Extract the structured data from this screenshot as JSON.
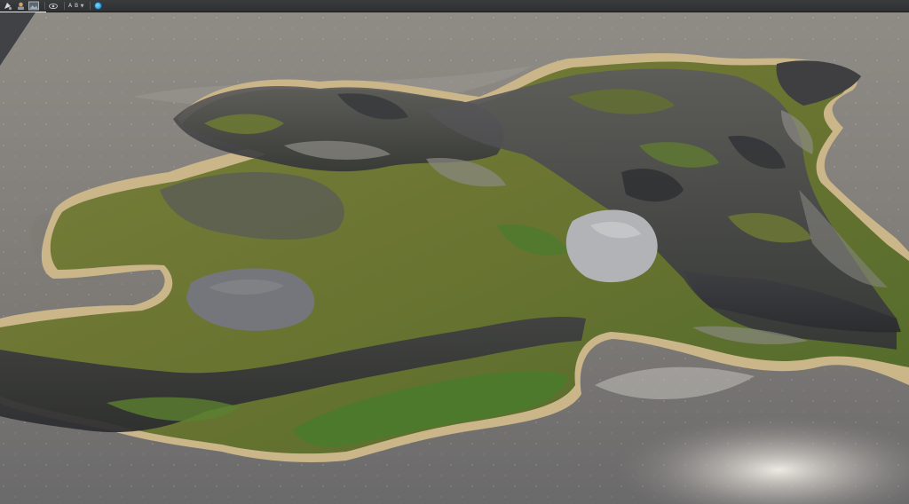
{
  "toolbar": {
    "items": [
      {
        "name": "transform-tool-icon",
        "icon": "transform-icon"
      },
      {
        "name": "camera-tool-icon",
        "icon": "camera-icon"
      },
      {
        "name": "render-preview-icon",
        "icon": "image-icon"
      },
      {
        "name": "visibility-icon",
        "icon": "eye-icon"
      }
    ],
    "mode_label": "A B",
    "active_indicator_color": "#1a87c8"
  },
  "colors": {
    "water": "#8e8a84",
    "sand": "#cdb98a",
    "grass": "#6f7a34",
    "rock": "#4a4a4e",
    "lake": "#a9aaae",
    "toolbar_bg": "#333436"
  }
}
